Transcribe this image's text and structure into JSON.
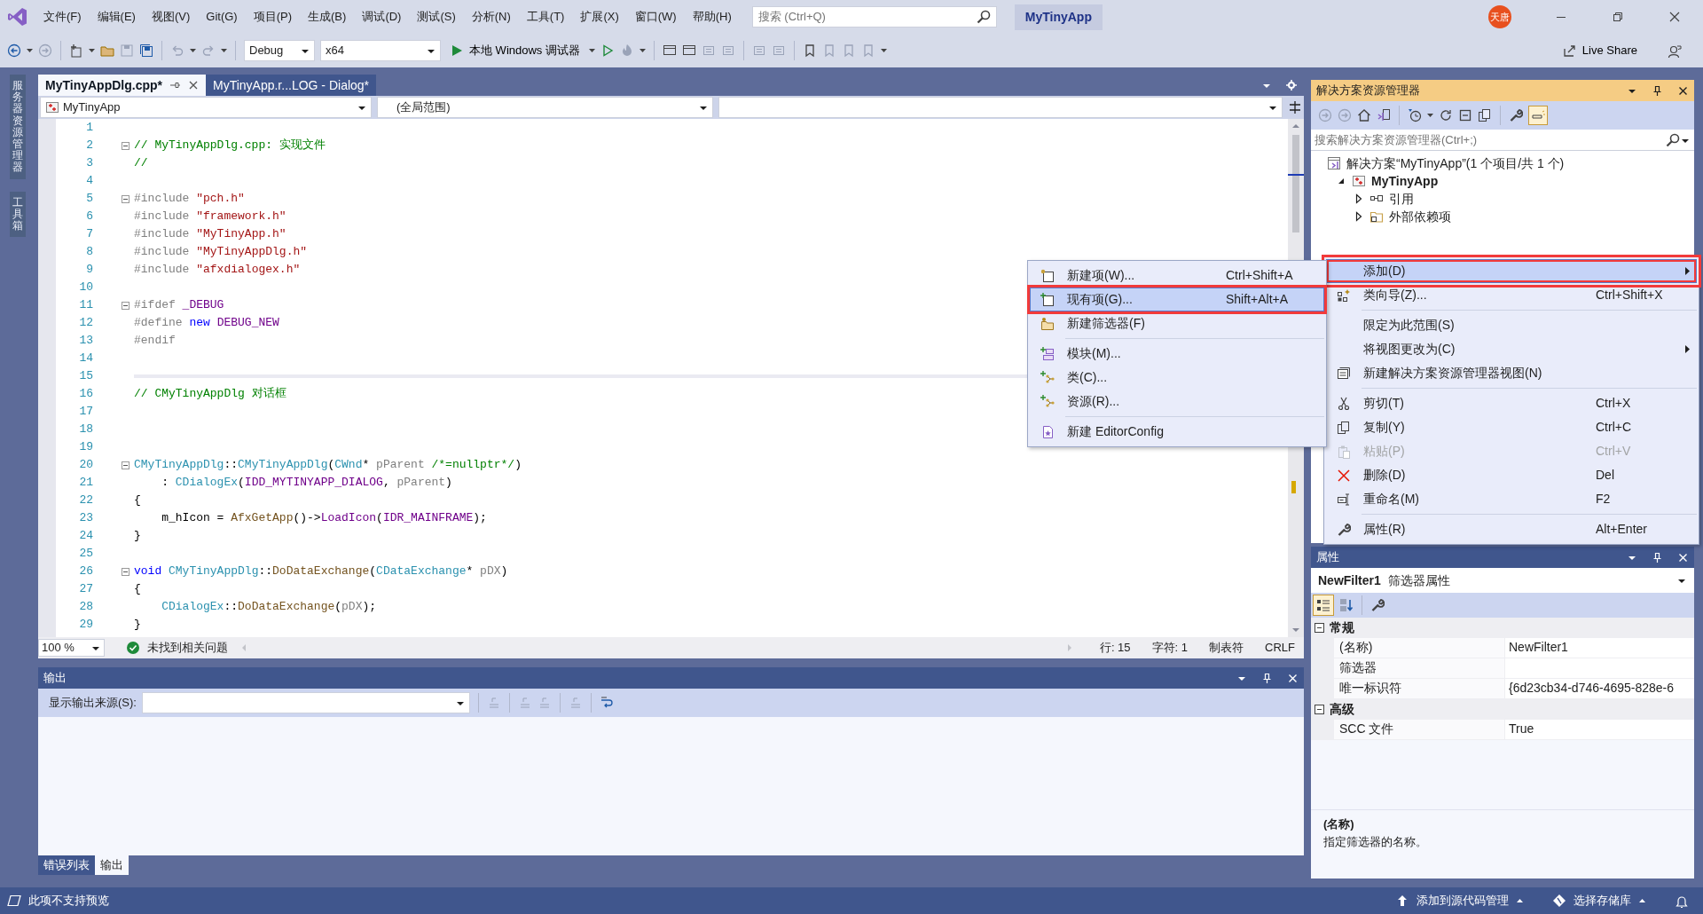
{
  "title_bar": {
    "menus": [
      "文件(F)",
      "编辑(E)",
      "视图(V)",
      "Git(G)",
      "项目(P)",
      "生成(B)",
      "调试(D)",
      "测试(S)",
      "分析(N)",
      "工具(T)",
      "扩展(X)",
      "窗口(W)",
      "帮助(H)"
    ],
    "search": {
      "placeholder": "搜索 (Ctrl+Q)"
    },
    "solution_name": "MyTinyApp",
    "user_badge": "天唐"
  },
  "toolbar": {
    "configuration": "Debug",
    "platform": "x64",
    "run_label": "本地 Windows 调试器",
    "live_share": "Live Share"
  },
  "side_tabs": [
    "服务器资源管理器",
    "工具箱"
  ],
  "editor": {
    "tabs": [
      {
        "label": "MyTinyAppDlg.cpp*",
        "selected": true
      },
      {
        "label": "MyTinyApp.r...LOG - Dialog*",
        "selected": false
      }
    ],
    "nav": [
      "MyTinyApp",
      "(全局范围)"
    ],
    "lines": [
      {
        "number": "1",
        "fold_start": false,
        "current": false
      },
      {
        "number": "2",
        "fold_start": true,
        "current": false,
        "tokens": [
          {
            "text": "// MyTinyAppDlg.cpp: 实现文件",
            "kind": "comment"
          }
        ]
      },
      {
        "number": "3",
        "fold_start": false,
        "current": false,
        "tokens": [
          {
            "text": "//",
            "kind": "comment"
          }
        ]
      },
      {
        "number": "4",
        "fold_start": false,
        "current": false
      },
      {
        "number": "5",
        "fold_start": true,
        "current": false,
        "tokens": [
          {
            "text": "#include ",
            "kind": "pre"
          },
          {
            "text": "\"pch.h\"",
            "kind": "string"
          }
        ]
      },
      {
        "number": "6",
        "fold_start": false,
        "current": false,
        "tokens": [
          {
            "text": "#include ",
            "kind": "pre"
          },
          {
            "text": "\"framework.h\"",
            "kind": "string"
          }
        ]
      },
      {
        "number": "7",
        "fold_start": false,
        "current": false,
        "tokens": [
          {
            "text": "#include ",
            "kind": "pre"
          },
          {
            "text": "\"MyTinyApp.h\"",
            "kind": "string"
          }
        ]
      },
      {
        "number": "8",
        "fold_start": false,
        "current": false,
        "tokens": [
          {
            "text": "#include ",
            "kind": "pre"
          },
          {
            "text": "\"MyTinyAppDlg.h\"",
            "kind": "string"
          }
        ]
      },
      {
        "number": "9",
        "fold_start": false,
        "current": false,
        "tokens": [
          {
            "text": "#include ",
            "kind": "pre"
          },
          {
            "text": "\"afxdialogex.h\"",
            "kind": "string"
          }
        ]
      },
      {
        "number": "10",
        "fold_start": false,
        "current": false
      },
      {
        "number": "11",
        "fold_start": true,
        "current": false,
        "tokens": [
          {
            "text": "#ifdef ",
            "kind": "pre"
          },
          {
            "text": "_DEBUG",
            "kind": "macro"
          }
        ]
      },
      {
        "number": "12",
        "fold_start": false,
        "current": false,
        "tokens": [
          {
            "text": "#define ",
            "kind": "pre"
          },
          {
            "text": "new ",
            "kind": "keyword"
          },
          {
            "text": "DEBUG_NEW",
            "kind": "macro"
          }
        ]
      },
      {
        "number": "13",
        "fold_start": false,
        "current": false,
        "tokens": [
          {
            "text": "#endif",
            "kind": "pre"
          }
        ]
      },
      {
        "number": "14",
        "fold_start": false,
        "current": false
      },
      {
        "number": "15",
        "fold_start": false,
        "current": true
      },
      {
        "number": "16",
        "fold_start": false,
        "current": false,
        "tokens": [
          {
            "text": "// CMyTinyAppDlg 对话框",
            "kind": "comment"
          }
        ]
      },
      {
        "number": "17",
        "fold_start": false,
        "current": false
      },
      {
        "number": "18",
        "fold_start": false,
        "current": false
      },
      {
        "number": "19",
        "fold_start": false,
        "current": false
      },
      {
        "number": "20",
        "fold_start": true,
        "current": false,
        "tokens": [
          {
            "text": "CMyTinyAppDlg",
            "kind": "type"
          },
          {
            "text": "::",
            "kind": "plain"
          },
          {
            "text": "CMyTinyAppDlg",
            "kind": "type"
          },
          {
            "text": "(",
            "kind": "plain"
          },
          {
            "text": "CWnd",
            "kind": "type"
          },
          {
            "text": "* ",
            "kind": "plain"
          },
          {
            "text": "pParent ",
            "kind": "param"
          },
          {
            "text": "/*=nullptr*/",
            "kind": "comment"
          },
          {
            "text": ")",
            "kind": "plain"
          }
        ]
      },
      {
        "number": "21",
        "fold_start": false,
        "current": false,
        "tokens": [
          {
            "text": "    : ",
            "kind": "plain"
          },
          {
            "text": "CDialogEx",
            "kind": "type"
          },
          {
            "text": "(",
            "kind": "plain"
          },
          {
            "text": "IDD_MYTINYAPP_DIALOG",
            "kind": "macro"
          },
          {
            "text": ", ",
            "kind": "plain"
          },
          {
            "text": "pParent",
            "kind": "param"
          },
          {
            "text": ")",
            "kind": "plain"
          }
        ]
      },
      {
        "number": "22",
        "fold_start": false,
        "current": false,
        "tokens": [
          {
            "text": "{",
            "kind": "plain"
          }
        ]
      },
      {
        "number": "23",
        "fold_start": false,
        "current": false,
        "tokens": [
          {
            "text": "    m_hIcon = ",
            "kind": "plain"
          },
          {
            "text": "AfxGetApp",
            "kind": "func"
          },
          {
            "text": "()->",
            "kind": "plain"
          },
          {
            "text": "LoadIcon",
            "kind": "macro"
          },
          {
            "text": "(",
            "kind": "plain"
          },
          {
            "text": "IDR_MAINFRAME",
            "kind": "macro"
          },
          {
            "text": ");",
            "kind": "plain"
          }
        ]
      },
      {
        "number": "24",
        "fold_start": false,
        "current": false,
        "tokens": [
          {
            "text": "}",
            "kind": "plain"
          }
        ]
      },
      {
        "number": "25",
        "fold_start": false,
        "current": false
      },
      {
        "number": "26",
        "fold_start": true,
        "current": false,
        "tokens": [
          {
            "text": "void ",
            "kind": "keyword"
          },
          {
            "text": "CMyTinyAppDlg",
            "kind": "type"
          },
          {
            "text": "::",
            "kind": "plain"
          },
          {
            "text": "DoDataExchange",
            "kind": "func"
          },
          {
            "text": "(",
            "kind": "plain"
          },
          {
            "text": "CDataExchange",
            "kind": "type"
          },
          {
            "text": "* ",
            "kind": "plain"
          },
          {
            "text": "pDX",
            "kind": "param"
          },
          {
            "text": ")",
            "kind": "plain"
          }
        ]
      },
      {
        "number": "27",
        "fold_start": false,
        "current": false,
        "tokens": [
          {
            "text": "{",
            "kind": "plain"
          }
        ]
      },
      {
        "number": "28",
        "fold_start": false,
        "current": false,
        "tokens": [
          {
            "text": "    CDialogEx",
            "kind": "type"
          },
          {
            "text": "::",
            "kind": "plain"
          },
          {
            "text": "DoDataExchange",
            "kind": "func"
          },
          {
            "text": "(",
            "kind": "plain"
          },
          {
            "text": "pDX",
            "kind": "param"
          },
          {
            "text": ");",
            "kind": "plain"
          }
        ]
      },
      {
        "number": "29",
        "fold_start": false,
        "current": false,
        "tokens": [
          {
            "text": "}",
            "kind": "plain"
          }
        ]
      }
    ],
    "zoom": "100 %",
    "issues": "未找到相关问题",
    "position": [
      "行: 15",
      "字符: 1",
      "制表符",
      "CRLF"
    ]
  },
  "output": {
    "title": "输出",
    "source_label": "显示输出来源(S):",
    "tabs": [
      {
        "label": "错误列表",
        "selected": false
      },
      {
        "label": "输出",
        "selected": true
      }
    ]
  },
  "solution_explorer": {
    "title": "解决方案资源管理器",
    "search": {
      "placeholder": "搜索解决方案资源管理器(Ctrl+;)"
    },
    "tree": [
      {
        "label": "解决方案“MyTinyApp”(1 个项目/共 1 个)",
        "children": [
          {
            "label": "MyTinyApp",
            "expanded": true,
            "children": [
              {
                "label": "引用",
                "expanded": false
              },
              {
                "label": "外部依赖项",
                "expanded": false
              }
            ]
          }
        ]
      }
    ]
  },
  "context_menu": {
    "items": [
      {
        "kind": "item",
        "label": "添加(D)",
        "submenu": true,
        "selected": true,
        "disabled": false,
        "annotated": true
      },
      {
        "kind": "item",
        "label": "类向导(Z)...",
        "shortcut": "Ctrl+Shift+X",
        "submenu": false,
        "selected": false,
        "disabled": false,
        "annotated": false
      },
      {
        "kind": "separator"
      },
      {
        "kind": "item",
        "label": "限定为此范围(S)",
        "submenu": false,
        "selected": false,
        "disabled": false,
        "annotated": false
      },
      {
        "kind": "item",
        "label": "将视图更改为(C)",
        "submenu": true,
        "selected": false,
        "disabled": false,
        "annotated": false
      },
      {
        "kind": "item",
        "label": "新建解决方案资源管理器视图(N)",
        "submenu": false,
        "selected": false,
        "disabled": false,
        "annotated": false
      },
      {
        "kind": "separator"
      },
      {
        "kind": "item",
        "label": "剪切(T)",
        "shortcut": "Ctrl+X",
        "submenu": false,
        "selected": false,
        "disabled": false,
        "annotated": false
      },
      {
        "kind": "item",
        "label": "复制(Y)",
        "shortcut": "Ctrl+C",
        "submenu": false,
        "selected": false,
        "disabled": false,
        "annotated": false
      },
      {
        "kind": "item",
        "label": "粘贴(P)",
        "shortcut": "Ctrl+V",
        "submenu": false,
        "selected": false,
        "disabled": true,
        "annotated": false
      },
      {
        "kind": "item",
        "label": "删除(D)",
        "shortcut": "Del",
        "submenu": false,
        "selected": false,
        "disabled": false,
        "annotated": false
      },
      {
        "kind": "item",
        "label": "重命名(M)",
        "shortcut": "F2",
        "submenu": false,
        "selected": false,
        "disabled": false,
        "annotated": false
      },
      {
        "kind": "separator"
      },
      {
        "kind": "item",
        "label": "属性(R)",
        "shortcut": "Alt+Enter",
        "submenu": false,
        "selected": false,
        "disabled": false,
        "annotated": false
      }
    ]
  },
  "submenu": {
    "items": [
      {
        "kind": "item",
        "label": "新建项(W)...",
        "shortcut": "Ctrl+Shift+A",
        "selected": false,
        "annotated": false
      },
      {
        "kind": "item",
        "label": "现有项(G)...",
        "shortcut": "Shift+Alt+A",
        "selected": true,
        "annotated": true
      },
      {
        "kind": "item",
        "label": "新建筛选器(F)",
        "selected": false,
        "annotated": false
      },
      {
        "kind": "separator"
      },
      {
        "kind": "item",
        "label": "模块(M)...",
        "selected": false,
        "annotated": false
      },
      {
        "kind": "item",
        "label": "类(C)...",
        "selected": false,
        "annotated": false
      },
      {
        "kind": "item",
        "label": "资源(R)...",
        "selected": false,
        "annotated": false
      },
      {
        "kind": "separator"
      },
      {
        "kind": "item",
        "label": "新建 EditorConfig",
        "selected": false,
        "annotated": false
      }
    ]
  },
  "properties": {
    "title": "属性",
    "object_name": "NewFilter1",
    "object_type": "筛选器属性",
    "groups": [
      {
        "label": "常规",
        "expanded": true,
        "rows": [
          {
            "name": "(名称)",
            "value": "NewFilter1"
          },
          {
            "name": "筛选器"
          },
          {
            "name": "唯一标识符",
            "value": "{6d23cb34-d746-4695-828e-6"
          }
        ]
      },
      {
        "label": "高级",
        "expanded": true,
        "rows": [
          {
            "name": "SCC 文件",
            "value": "True"
          }
        ]
      }
    ],
    "description": {
      "title": "(名称)",
      "text": "指定筛选器的名称。"
    }
  },
  "status_bar": {
    "message": "此项不支持预览",
    "source_control": "添加到源代码管理",
    "repository": "选择存储库"
  }
}
